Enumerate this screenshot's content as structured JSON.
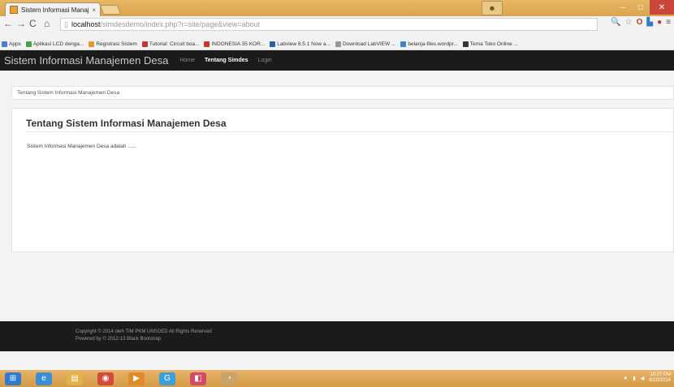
{
  "browser": {
    "tab_title": "Sistem Informasi Manaje",
    "tab_close": "×",
    "url_host": "localhost",
    "url_path": "/simdesdemo/index.php?r=site/page&view=about",
    "bookmarks": [
      {
        "label": "Apps",
        "color": "#4a7fd0"
      },
      {
        "label": "Aplikasi LCD denga...",
        "color": "#46a34a"
      },
      {
        "label": "Registrasi Sistem",
        "color": "#e59a2b"
      },
      {
        "label": "Tutorial: Circuit boa...",
        "color": "#c0392b"
      },
      {
        "label": "INDONESIA 35 KOR...",
        "color": "#c0392b"
      },
      {
        "label": "Labview 8.5.1 Now a...",
        "color": "#2b5fa8"
      },
      {
        "label": "Download LabVIEW ...",
        "color": "#999999"
      },
      {
        "label": "belanja-files.wordpr...",
        "color": "#3a87c9"
      },
      {
        "label": "Tema Toko Online ...",
        "color": "#333333"
      }
    ]
  },
  "navbar": {
    "brand": "Sistem Informasi Manajemen Desa",
    "links": [
      {
        "label": "Home",
        "active": false
      },
      {
        "label": "Tentang Simdes",
        "active": true
      },
      {
        "label": "Login",
        "active": false
      }
    ]
  },
  "breadcrumb": "Tentang Sistem Informasi Manajemen Desa",
  "content": {
    "title": "Tentang Sistem Informasi Manajemen Desa",
    "body": "Sistem Informasi Manajemen Desa adalah ......"
  },
  "footer": {
    "line1": "Copyright © 2014 oleh TIM PKM UNSOED All Rights Reserved",
    "line2": "Powered by © 2012-13 Black Bootstrap"
  },
  "taskbar": {
    "clock_time": "10:27 PM",
    "clock_date": "6/20/2014"
  }
}
